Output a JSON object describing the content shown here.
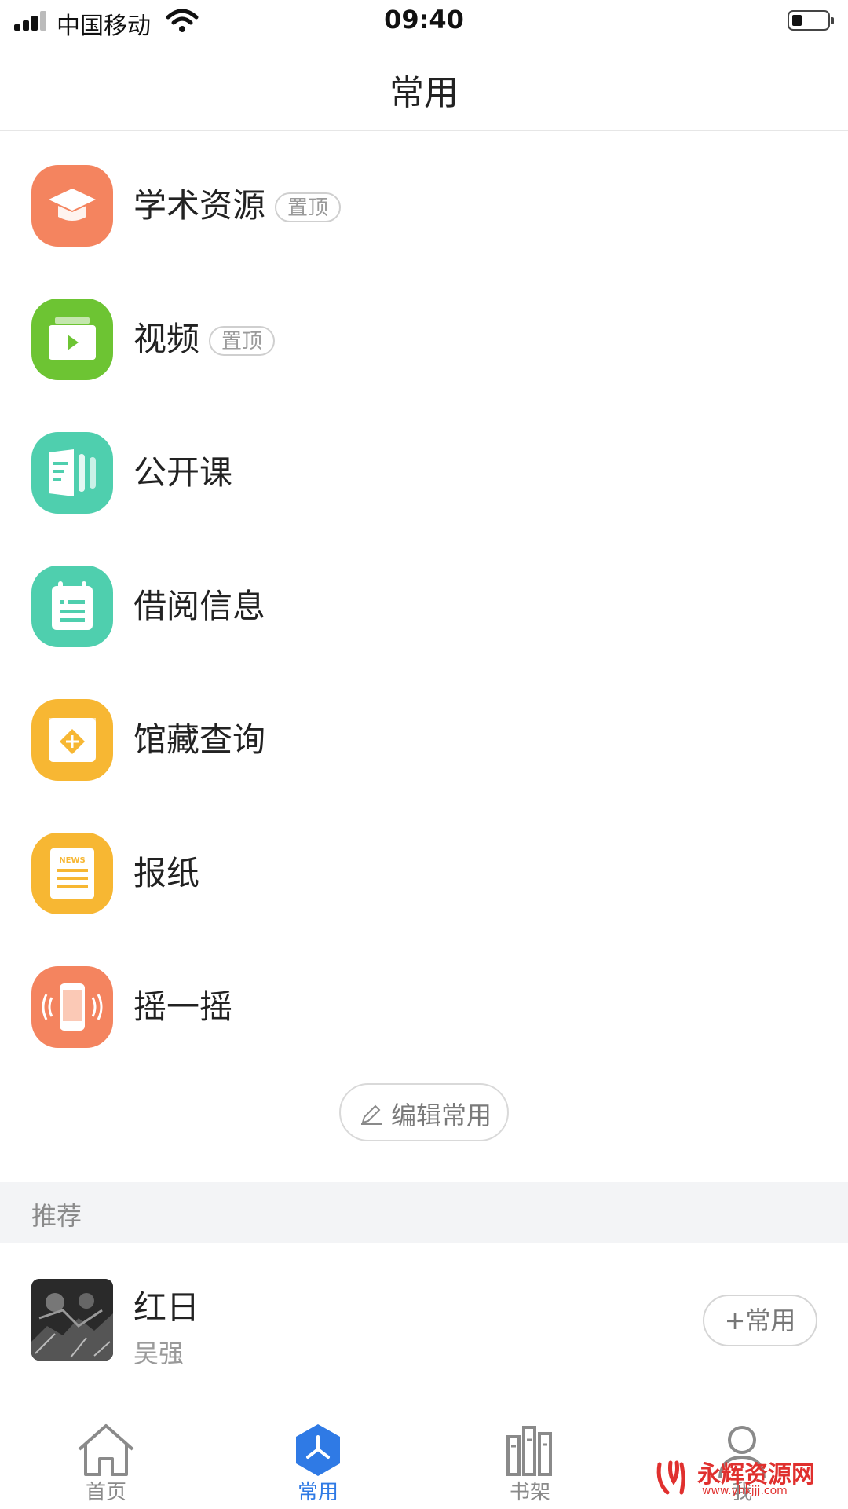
{
  "status_bar": {
    "carrier": "中国移动",
    "time": "09:40"
  },
  "nav": {
    "title": "常用"
  },
  "favorites": [
    {
      "label": "学术资源",
      "pinned": true,
      "pin_label": "置顶",
      "icon": "graduation-cap-icon",
      "color": "#F4845F"
    },
    {
      "label": "视频",
      "pinned": true,
      "pin_label": "置顶",
      "icon": "video-play-icon",
      "color": "#6DC433"
    },
    {
      "label": "公开课",
      "pinned": false,
      "icon": "open-course-icon",
      "color": "#4FCFAE"
    },
    {
      "label": "借阅信息",
      "pinned": false,
      "icon": "calendar-list-icon",
      "color": "#4FCFAE"
    },
    {
      "label": "馆藏查询",
      "pinned": false,
      "icon": "collection-search-icon",
      "color": "#F7B733"
    },
    {
      "label": "报纸",
      "pinned": false,
      "icon": "newspaper-icon",
      "color": "#F7B733",
      "icon_text": "NEWS"
    },
    {
      "label": "摇一摇",
      "pinned": false,
      "icon": "shake-phone-icon",
      "color": "#F4845F"
    }
  ],
  "edit_button": {
    "label": "编辑常用"
  },
  "recommend": {
    "header": "推荐",
    "items": [
      {
        "title": "红日",
        "author": "吴强",
        "add_label": "+常用"
      }
    ]
  },
  "tab_bar": {
    "tabs": [
      {
        "label": "首页",
        "icon": "home-icon",
        "active": false
      },
      {
        "label": "常用",
        "icon": "favorites-hex-icon",
        "active": true
      },
      {
        "label": "书架",
        "icon": "bookshelf-icon",
        "active": false
      },
      {
        "label": "我",
        "icon": "user-icon",
        "active": false
      }
    ],
    "active_color": "#2F7AE5"
  },
  "watermark": {
    "text": "永辉资源网",
    "url": "www.yhkjjj.com"
  }
}
